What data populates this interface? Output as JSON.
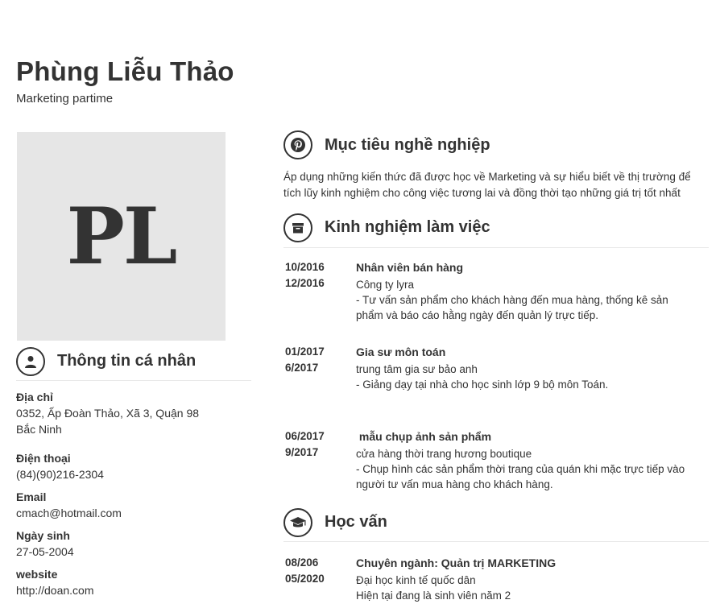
{
  "profile": {
    "name": "Phùng Liễu Thảo",
    "title": "Marketing partime",
    "initials": "PL"
  },
  "personal": {
    "heading": "Thông tin cá nhân",
    "icon": "user-icon",
    "address_label": "Địa chỉ",
    "address_line1": "0352, Ấp Đoàn Thảo, Xã 3, Quận 98",
    "address_line2": "Bắc Ninh",
    "phone_label": "Điện thoại",
    "phone": "(84)(90)216-2304",
    "email_label": "Email",
    "email": "cmach@hotmail.com",
    "birthday_label": "Ngày sinh",
    "birthday": "27-05-2004",
    "website_label": "website",
    "website": "http://doan.com"
  },
  "objective": {
    "heading": "Mục tiêu nghề nghiệp",
    "icon": "pinterest-icon",
    "line1": "Áp dụng những kiến thức đã được học về Marketing và sự hiểu biết về thị trường để",
    "line2": "tích lũy kinh nghiệm cho công việc tương lai và đồng thời tạo những giá trị tốt nhất"
  },
  "experience": {
    "heading": "Kinh nghiệm làm việc",
    "icon": "archive-box-icon",
    "items": [
      {
        "start": "10/2016",
        "end": "12/2016",
        "title": "Nhân viên bán hàng",
        "company": "Công ty lyra",
        "desc1": "- Tư vấn sản phẩm cho khách hàng đến mua hàng, thống kê sản",
        "desc2": "phẩm và báo cáo hằng ngày đến quản lý trực tiếp."
      },
      {
        "start": "01/2017",
        "end": "6/2017",
        "title": "Gia sư môn toán",
        "company": "trung tâm gia sư bảo anh",
        "desc1": "- Giảng dạy tại nhà cho học sinh lớp 9 bộ môn Toán.",
        "desc2": ""
      },
      {
        "start": "06/2017",
        "end": "9/2017",
        "title": " mẫu chụp ảnh sản phẩm",
        "company": "cửa hàng thời trang hương boutique",
        "desc1": "- Chụp hình các sản phẩm thời trang của quán khi mặc trực tiếp vào",
        "desc2": "người tư vấn mua hàng cho khách hàng."
      }
    ]
  },
  "education": {
    "heading": "Học vấn",
    "icon": "graduation-cap-icon",
    "items": [
      {
        "start": "08/206",
        "end": "05/2020",
        "title": "Chuyên ngành: Quản trị MARKETING",
        "school": "Đại học kinh tế quốc dân",
        "note": "Hiện tại đang là sinh viên năm 2"
      }
    ]
  }
}
